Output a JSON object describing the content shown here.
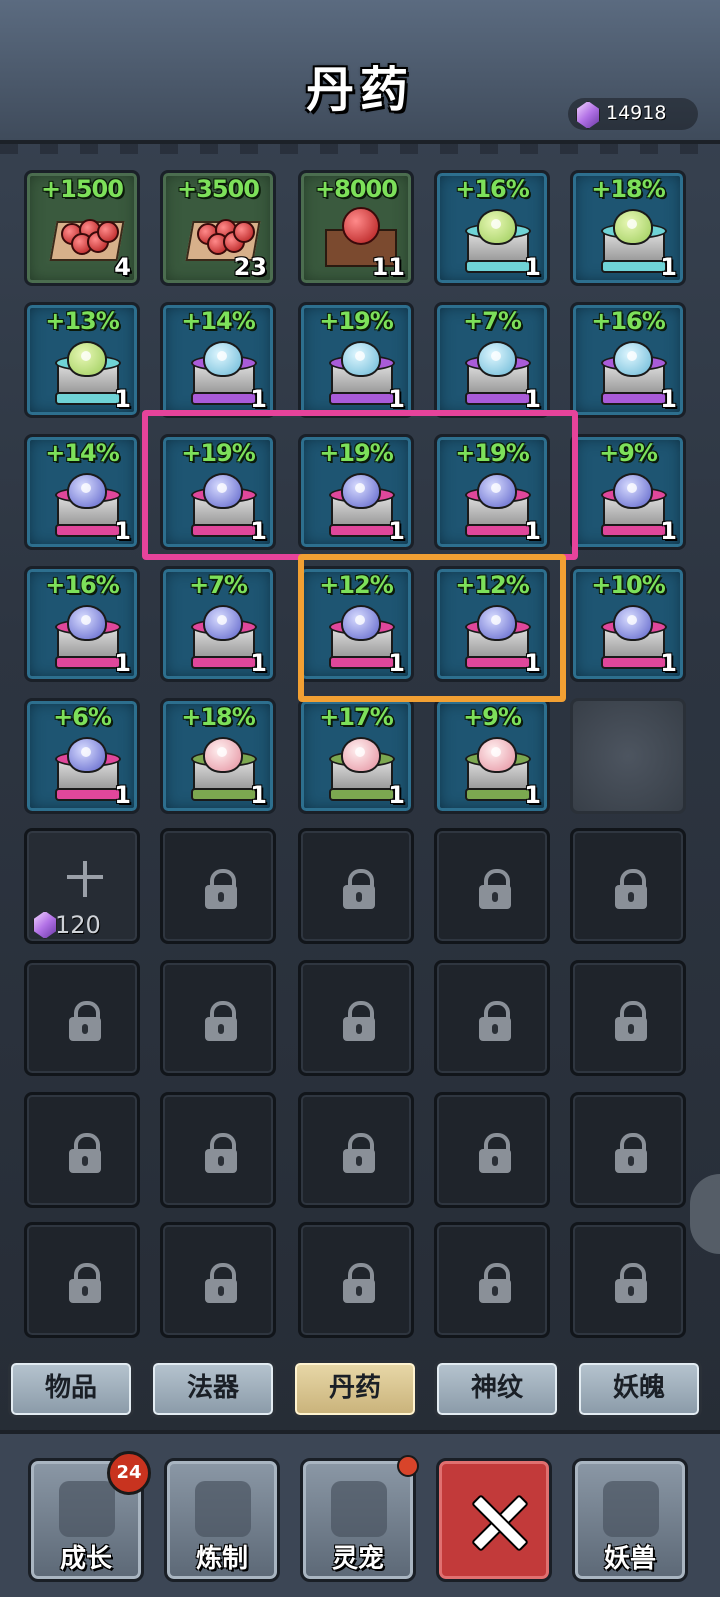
{
  "header": {
    "title": "丹药",
    "currency": {
      "icon": "purple-gem-icon",
      "value": "14918"
    }
  },
  "colors": {
    "stat_green": "#7de05a",
    "highlight_pink": "#e6439b",
    "highlight_orange": "#f2a033",
    "tab_active": "#e8d8a8"
  },
  "items": [
    {
      "stat": "+1500",
      "count": "4",
      "icon": "red-berries-on-mat-icon"
    },
    {
      "stat": "+3500",
      "count": "23",
      "icon": "red-berries-on-tray-icon"
    },
    {
      "stat": "+8000",
      "count": "11",
      "icon": "red-pill-in-box-icon"
    },
    {
      "stat": "+16%",
      "count": "1",
      "icon": "green-pill-cyan-pedestal-icon"
    },
    {
      "stat": "+18%",
      "count": "1",
      "icon": "green-pill-cyan-pedestal-icon"
    },
    {
      "stat": "+13%",
      "count": "1",
      "icon": "green-pill-cyan-pedestal-icon"
    },
    {
      "stat": "+14%",
      "count": "1",
      "icon": "cyan-pill-purple-pedestal-icon"
    },
    {
      "stat": "+19%",
      "count": "1",
      "icon": "cyan-pill-purple-pedestal-icon"
    },
    {
      "stat": "+7%",
      "count": "1",
      "icon": "cyan-pill-purple-pedestal-icon"
    },
    {
      "stat": "+16%",
      "count": "1",
      "icon": "cyan-pill-purple-pedestal-icon"
    },
    {
      "stat": "+14%",
      "count": "1",
      "icon": "blue-pill-pink-pedestal-icon"
    },
    {
      "stat": "+19%",
      "count": "1",
      "icon": "blue-pill-pink-pedestal-icon"
    },
    {
      "stat": "+19%",
      "count": "1",
      "icon": "blue-pill-pink-pedestal-icon"
    },
    {
      "stat": "+19%",
      "count": "1",
      "icon": "blue-pill-pink-pedestal-icon"
    },
    {
      "stat": "+9%",
      "count": "1",
      "icon": "blue-pill-pink-pedestal-icon"
    },
    {
      "stat": "+16%",
      "count": "1",
      "icon": "blue-pill-pink-pedestal-icon"
    },
    {
      "stat": "+7%",
      "count": "1",
      "icon": "blue-pill-pink-pedestal-icon"
    },
    {
      "stat": "+12%",
      "count": "1",
      "icon": "blue-pill-pink-pedestal-icon"
    },
    {
      "stat": "+12%",
      "count": "1",
      "icon": "blue-pill-pink-pedestal-icon"
    },
    {
      "stat": "+10%",
      "count": "1",
      "icon": "blue-pill-pink-pedestal-icon"
    },
    {
      "stat": "+6%",
      "count": "1",
      "icon": "blue-pill-pink-pedestal-icon"
    },
    {
      "stat": "+18%",
      "count": "1",
      "icon": "pink-pill-green-pedestal-icon"
    },
    {
      "stat": "+17%",
      "count": "1",
      "icon": "pink-pill-green-pedestal-icon"
    },
    {
      "stat": "+9%",
      "count": "1",
      "icon": "pink-pill-green-pedestal-icon"
    }
  ],
  "empty_slots": 1,
  "unlock_slot": {
    "icon": "plus-icon",
    "cost_icon": "purple-gem-icon",
    "cost": "120"
  },
  "locked_slot_icon": "padlock-icon",
  "locked_slots": 19,
  "tabs": [
    {
      "label": "物品",
      "active": false
    },
    {
      "label": "法器",
      "active": false
    },
    {
      "label": "丹药",
      "active": true
    },
    {
      "label": "神纹",
      "active": false
    },
    {
      "label": "妖魄",
      "active": false
    }
  ],
  "nav": [
    {
      "label": "成长",
      "icon": "cards-icon",
      "badge": "24"
    },
    {
      "label": "炼制",
      "icon": "hammer-anvil-icon",
      "badge": ""
    },
    {
      "label": "灵宠",
      "icon": "egg-icon",
      "dot": true
    },
    {
      "label": "",
      "icon": "close-icon"
    },
    {
      "label": "妖兽",
      "icon": "fox-demon-icon",
      "badge": ""
    }
  ]
}
